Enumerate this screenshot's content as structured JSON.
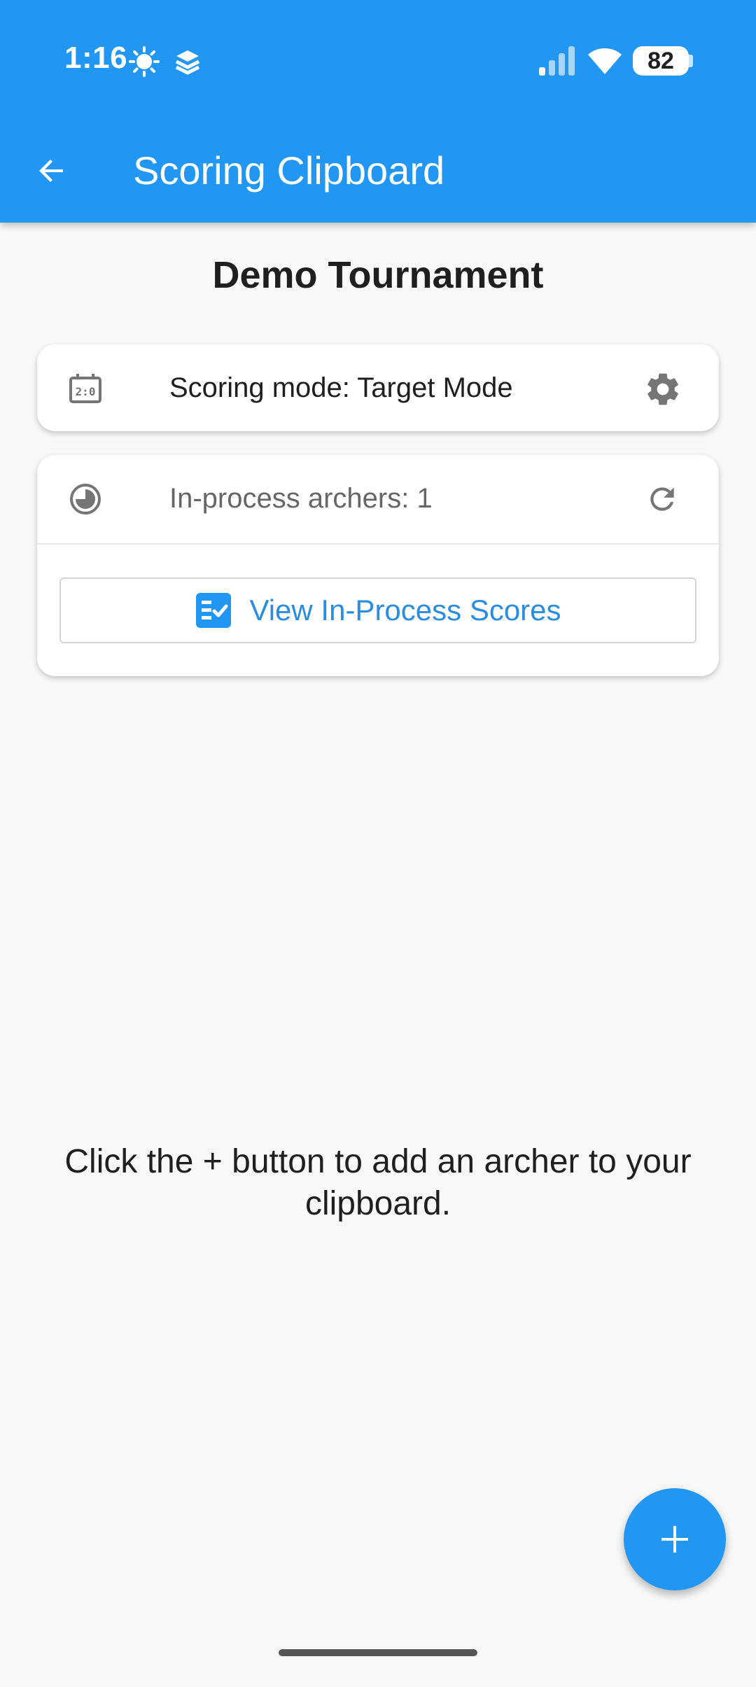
{
  "status_bar": {
    "time": "1:16",
    "battery": "82",
    "icons": [
      "settings-sun-icon",
      "stacked-layers-icon",
      "cellular-signal-icon",
      "wifi-icon",
      "battery-icon"
    ]
  },
  "app_bar": {
    "title": "Scoring Clipboard",
    "back_icon": "arrow-back-icon"
  },
  "tournament": {
    "name": "Demo Tournament"
  },
  "mode_card": {
    "text": "Scoring mode: Target Mode",
    "left_icon": "scoreboard-icon",
    "right_icon": "gear-icon"
  },
  "process_card": {
    "text": "In-process archers: 1",
    "left_icon": "pie-progress-icon",
    "right_icon": "refresh-icon",
    "button_label": "View In-Process Scores",
    "button_icon": "checklist-icon"
  },
  "empty_state": {
    "message": "Click the + button to add an archer to your clipboard."
  },
  "fab": {
    "icon": "plus-icon"
  },
  "colors": {
    "primary": "#2196f3",
    "accent_text": "#2a8de0",
    "background": "#f8f8f8"
  }
}
